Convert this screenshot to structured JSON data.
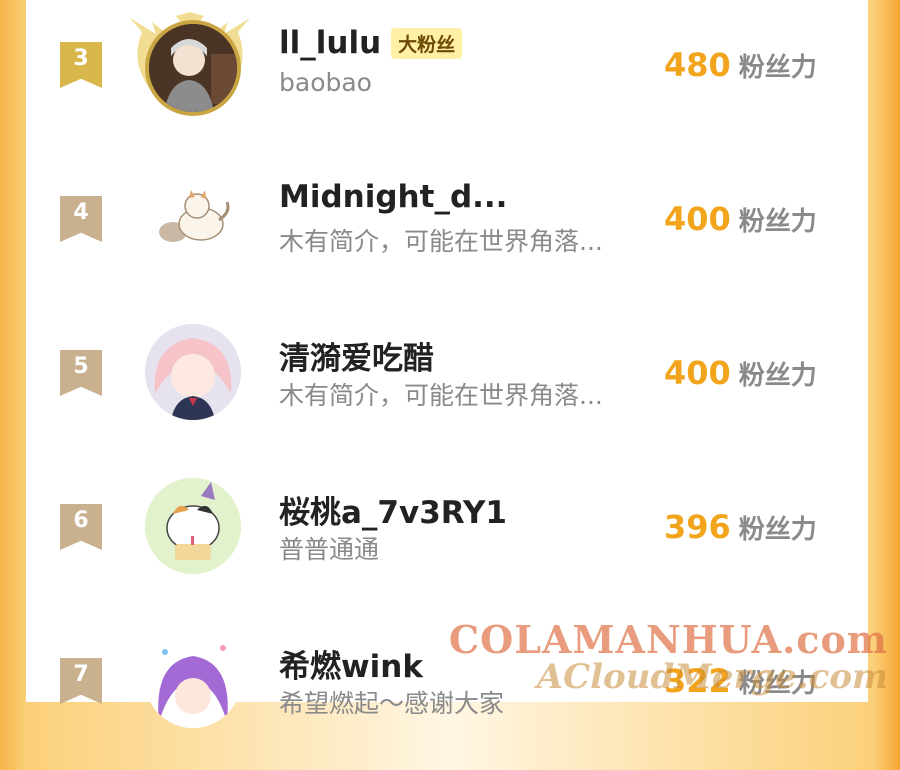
{
  "colors": {
    "accent_orange": "#f2a51c",
    "rank_gold": "#d8b64c",
    "rank_other": "#c9b08f",
    "fan_tag_bg": "#fff0a6"
  },
  "unit_label": "粉丝力",
  "rows": [
    {
      "rank": "3",
      "name": "ll_lulu",
      "tag": "大粉丝",
      "bio": "baobao",
      "score": "480"
    },
    {
      "rank": "4",
      "name": "Midnight_d...",
      "tag": "",
      "bio": "木有简介，可能在世界角落...",
      "score": "400"
    },
    {
      "rank": "5",
      "name": "清漪爱吃醋",
      "tag": "",
      "bio": "木有简介，可能在世界角落...",
      "score": "400"
    },
    {
      "rank": "6",
      "name": "桜桃a_7v3RY1",
      "tag": "",
      "bio": "普普通通",
      "score": "396"
    },
    {
      "rank": "7",
      "name": "希燃wink",
      "tag": "",
      "bio": "希望燃起～感谢大家",
      "score": "322"
    }
  ],
  "watermark": {
    "line1": "COLAMANHUA.com",
    "line2": "ACloudMerge.com"
  }
}
